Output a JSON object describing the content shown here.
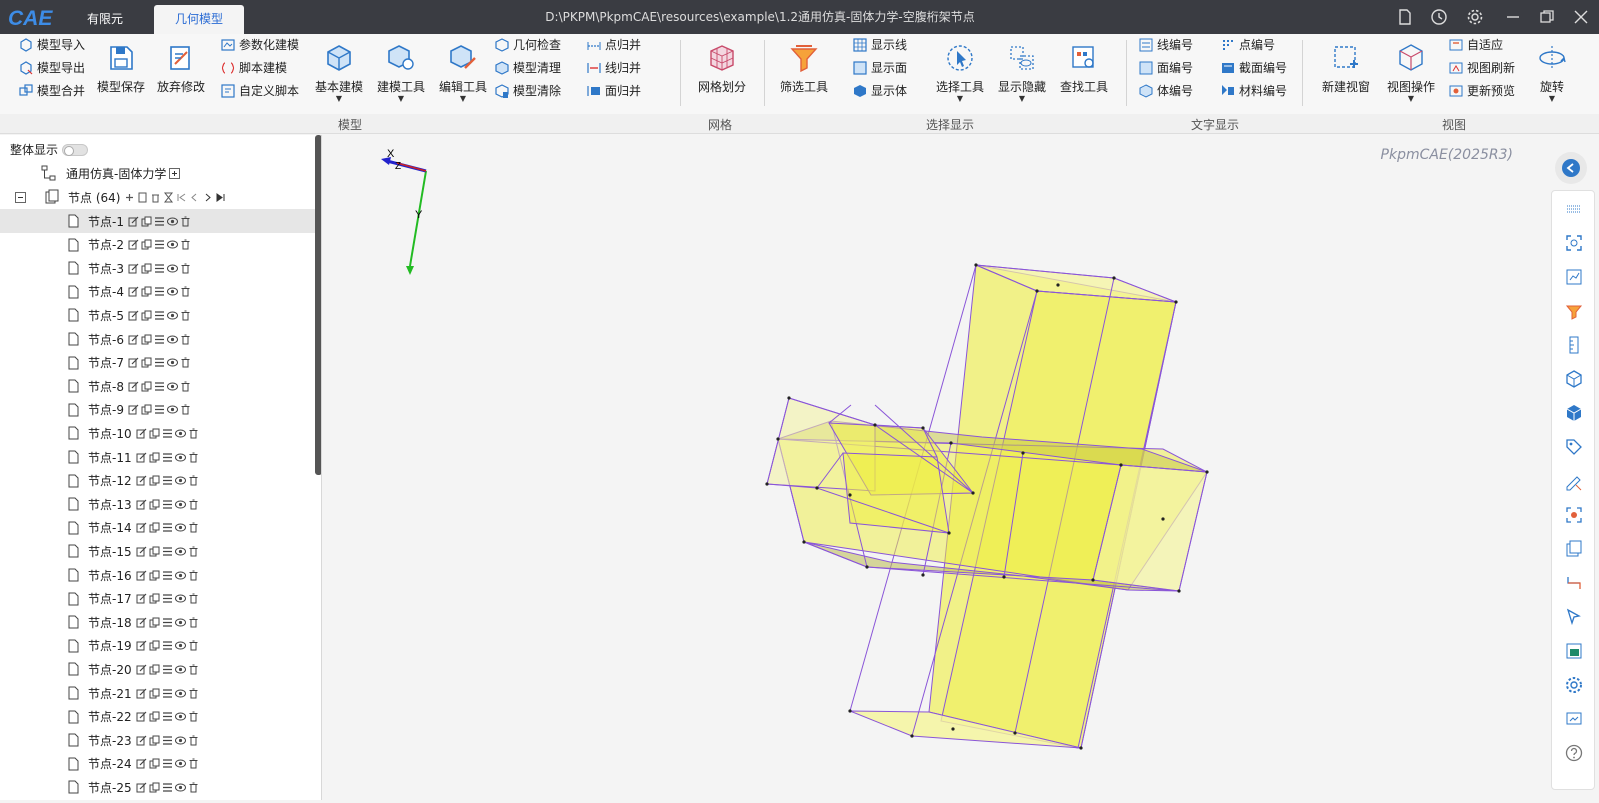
{
  "app": {
    "logo_text": "CAE",
    "tabs": [
      {
        "label": "有限元"
      },
      {
        "label": "几何模型"
      }
    ],
    "title_path": "D:\\PKPM\\PkpmCAE\\resources\\example\\1.2通用仿真-固体力学-空腹桁架节点"
  },
  "ribbon": {
    "model_small_col1": [
      "模型导入",
      "模型导出",
      "模型合并"
    ],
    "model_big1": [
      "模型保存",
      "放弃修改"
    ],
    "model_small_col2": [
      "参数化建模",
      "脚本建模",
      "自定义脚本"
    ],
    "model_big2": [
      "基本建模",
      "建模工具",
      "编辑工具"
    ],
    "model_small_col3": [
      "几何检查",
      "模型清理",
      "模型清除"
    ],
    "model_small_col4": [
      "点归并",
      "线归并",
      "面归并"
    ],
    "mesh_big": "网格划分",
    "filter_big": "筛选工具",
    "display_small": [
      "显示线",
      "显示面",
      "显示体"
    ],
    "select_big": [
      "选择工具",
      "显示隐藏",
      "查找工具"
    ],
    "text_small_col1": [
      "线编号",
      "面编号",
      "体编号"
    ],
    "text_small_col2": [
      "点编号",
      "截面编号",
      "材料编号"
    ],
    "view_big": [
      "新建视窗",
      "视图操作"
    ],
    "view_small": [
      "自适应",
      "视图刷新",
      "更新预览"
    ],
    "rotate_big": "旋转",
    "group_labels": [
      "模型",
      "网格",
      "选择显示",
      "文字显示",
      "视图"
    ]
  },
  "tree": {
    "overall_display_label": "整体显示",
    "root_label": "通用仿真-固体力学",
    "nodes_label": "节点 (64)",
    "items": [
      "节点-1",
      "节点-2",
      "节点-3",
      "节点-4",
      "节点-5",
      "节点-6",
      "节点-7",
      "节点-8",
      "节点-9",
      "节点-10",
      "节点-11",
      "节点-12",
      "节点-13",
      "节点-14",
      "节点-15",
      "节点-16",
      "节点-17",
      "节点-18",
      "节点-19",
      "节点-20",
      "节点-21",
      "节点-22",
      "节点-23",
      "节点-24",
      "节点-25"
    ]
  },
  "viewport": {
    "watermark": "PkpmCAE(2025R3)",
    "axis_x": "X",
    "axis_y": "Y",
    "axis_z": "Z",
    "model_fill": "#eeee40",
    "edge_color": "#8a55d8"
  },
  "colors": {
    "titlebar": "#3a3c42",
    "accent": "#2b6cd4",
    "icon_blue": "#2f78c8"
  }
}
